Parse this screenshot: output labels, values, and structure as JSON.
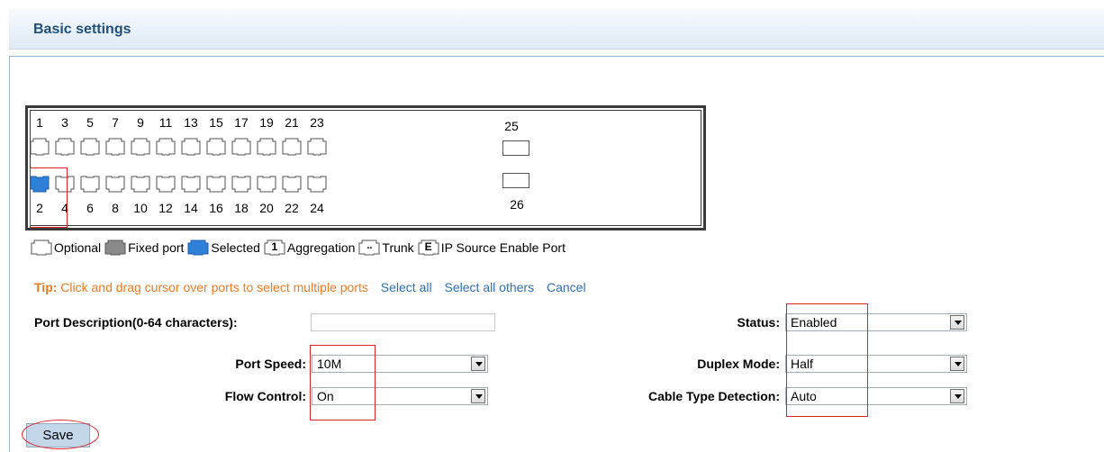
{
  "header": {
    "title": "Basic settings"
  },
  "ports": {
    "top_numbers": [
      "1",
      "3",
      "5",
      "7",
      "9",
      "11",
      "13",
      "15",
      "17",
      "19",
      "21",
      "23",
      "25"
    ],
    "bottom_numbers": [
      "2",
      "4",
      "6",
      "8",
      "10",
      "12",
      "14",
      "16",
      "18",
      "20",
      "22",
      "24",
      "26"
    ],
    "selected_port": "2"
  },
  "legend": {
    "optional": "Optional",
    "fixed": "Fixed port",
    "selected": "Selected",
    "aggregation": "Aggregation",
    "aggregation_glyph": "1",
    "trunk": "Trunk",
    "trunk_glyph": "..",
    "ipsource": "IP Source Enable Port",
    "ipsource_glyph": "E"
  },
  "tip": {
    "label": "Tip:",
    "text": "Click and drag cursor over ports to select multiple ports",
    "select_all": "Select all",
    "select_all_others": "Select all others",
    "cancel": "Cancel"
  },
  "form": {
    "port_description_label": "Port Description(0-64 characters):",
    "port_description_value": "",
    "status_label": "Status:",
    "status_value": "Enabled",
    "port_speed_label": "Port Speed:",
    "port_speed_value": "10M",
    "duplex_label": "Duplex Mode:",
    "duplex_value": "Half",
    "flow_control_label": "Flow Control:",
    "flow_control_value": "On",
    "cable_type_label": "Cable Type Detection:",
    "cable_type_value": "Auto"
  },
  "buttons": {
    "save": "Save"
  },
  "colors": {
    "selected_port": "#2f80d8",
    "tip": "#f07a22",
    "link": "#2f6fb5",
    "highlight": "#e0242a"
  }
}
